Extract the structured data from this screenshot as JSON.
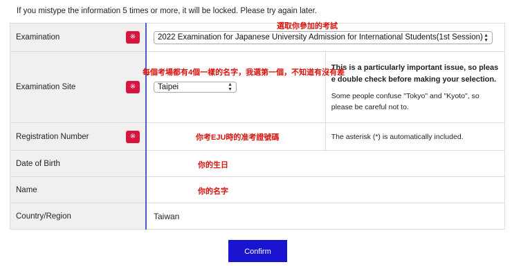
{
  "notice": "If you mistype the information 5 times or more, it will be locked. Please try again later.",
  "required_mark": "※",
  "rows": {
    "examination": {
      "label": "Examination",
      "value": "2022 Examination for Japanese University Admission for International Students(1st Session)"
    },
    "site": {
      "label": "Examination Site",
      "value": "Taipei",
      "note_bold": "This is a particularly important issue, so please double check before making your selection.",
      "note": "Some people confuse \"Tokyo\" and \"Kyoto\", so please be careful not to."
    },
    "registration": {
      "label": "Registration Number",
      "note": "The asterisk (*) is automatically included."
    },
    "dob": {
      "label": "Date of Birth"
    },
    "name": {
      "label": "Name"
    },
    "country": {
      "label": "Country/Region",
      "value": "Taiwan"
    }
  },
  "annotations": {
    "exam": "選取你參加的考試",
    "site": "每個考場都有4個一樣的名字，我選第一個，不知道有沒有差",
    "registration": "你考EJU時的准考證號碼",
    "dob": "你的生日",
    "name": "你的名字"
  },
  "confirm_label": "Confirm",
  "colors": {
    "required": "#d9143f",
    "confirm": "#1a14d0",
    "annotation": "#d9140f",
    "label_border": "#4a5cc8"
  }
}
